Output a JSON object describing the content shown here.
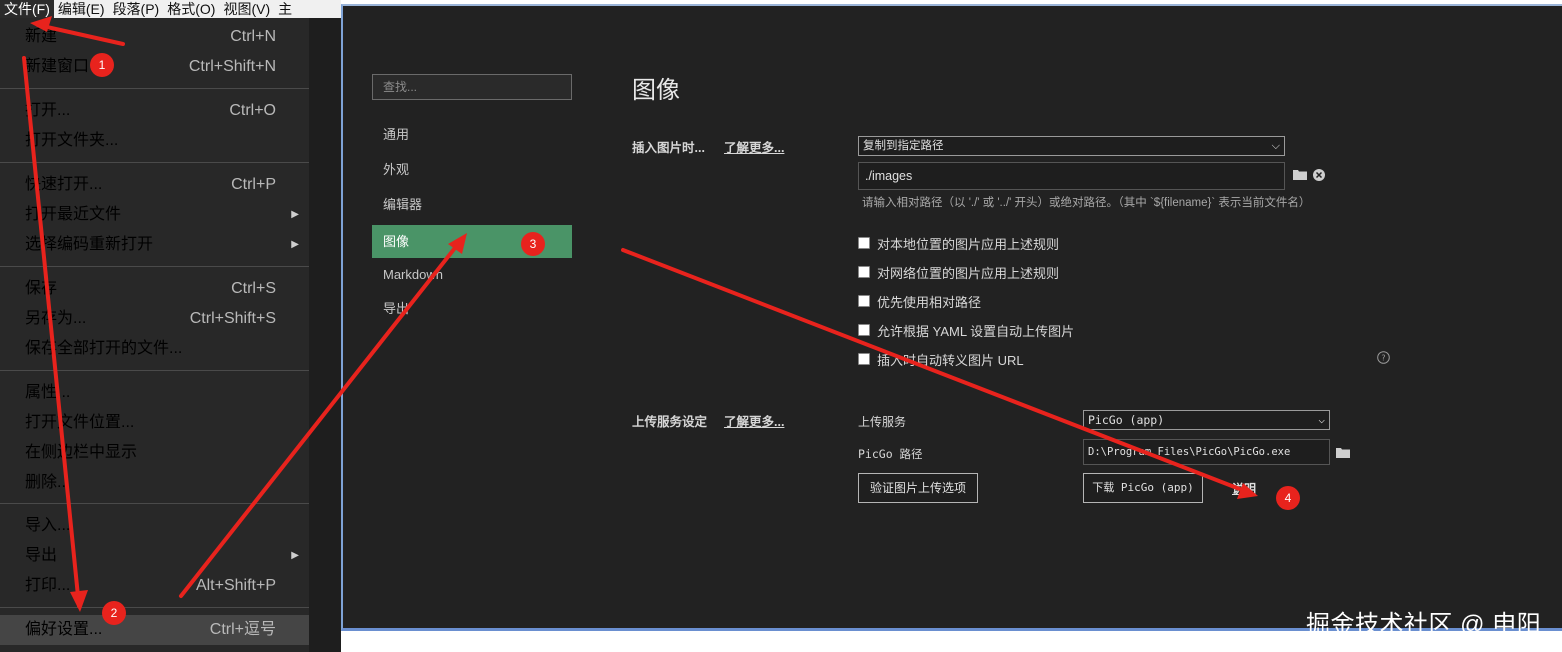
{
  "menubar": {
    "items": [
      "文件(F)",
      "编辑(E)",
      "段落(P)",
      "格式(O)",
      "视图(V)",
      "主"
    ]
  },
  "file_menu": {
    "items": [
      {
        "label": "新建",
        "shortcut": "Ctrl+N"
      },
      {
        "label": "新建窗口",
        "shortcut": "Ctrl+Shift+N"
      },
      {
        "label": "打开...",
        "shortcut": "Ctrl+O"
      },
      {
        "label": "打开文件夹...",
        "shortcut": ""
      },
      {
        "label": "快速打开...",
        "shortcut": "Ctrl+P"
      },
      {
        "label": "打开最近文件",
        "shortcut": "",
        "submenu": true
      },
      {
        "label": "选择编码重新打开",
        "shortcut": "",
        "submenu": true
      },
      {
        "label": "保存",
        "shortcut": "Ctrl+S"
      },
      {
        "label": "另存为...",
        "shortcut": "Ctrl+Shift+S"
      },
      {
        "label": "保存全部打开的文件...",
        "shortcut": ""
      },
      {
        "label": "属性...",
        "shortcut": ""
      },
      {
        "label": "打开文件位置...",
        "shortcut": ""
      },
      {
        "label": "在侧边栏中显示",
        "shortcut": ""
      },
      {
        "label": "删除...",
        "shortcut": ""
      },
      {
        "label": "导入...",
        "shortcut": ""
      },
      {
        "label": "导出",
        "shortcut": "",
        "submenu": true
      },
      {
        "label": "打印...",
        "shortcut": "Alt+Shift+P"
      },
      {
        "label": "偏好设置...",
        "shortcut": "Ctrl+逗号",
        "highlighted": true
      }
    ]
  },
  "preferences": {
    "search_placeholder": "查找...",
    "nav": [
      "通用",
      "外观",
      "编辑器",
      "图像",
      "Markdown",
      "导出"
    ],
    "selected_nav": "图像",
    "title": "图像",
    "insert_section": {
      "label": "插入图片时...",
      "learn_more": "了解更多...",
      "action_select": "复制到指定路径",
      "path_value": "./images",
      "path_hint": "请输入相对路径（以 './' 或 '../' 开头）或绝对路径。（其中 `${filename}` 表示当前文件名）",
      "options": [
        {
          "label": "对本地位置的图片应用上述规则",
          "checked": false
        },
        {
          "label": "对网络位置的图片应用上述规则",
          "checked": false
        },
        {
          "label": "优先使用相对路径",
          "checked": false
        },
        {
          "label": "允许根据 YAML 设置自动上传图片",
          "checked": false
        },
        {
          "label": "插入时自动转义图片 URL",
          "checked": false
        }
      ]
    },
    "upload_section": {
      "label": "上传服务设定",
      "learn_more": "了解更多...",
      "service_label": "上传服务",
      "service_value": "PicGo (app)",
      "path_label": "PicGo 路径",
      "path_value": "D:\\Program Files\\PicGo\\PicGo.exe",
      "verify_button": "验证图片上传选项",
      "download_button": "下载 PicGo (app)",
      "help_link": "说明"
    }
  },
  "annotations": {
    "badges": [
      "1",
      "2",
      "3",
      "4"
    ],
    "arrow_color": "#e8231d"
  },
  "watermark": "掘金技术社区 @ 申阳",
  "colors": {
    "menu_bg": "#282828",
    "menu_highlight": "#454545",
    "pref_bg": "#222222",
    "nav_selected": "#4a9467",
    "window_border": "#7fa3d6"
  }
}
